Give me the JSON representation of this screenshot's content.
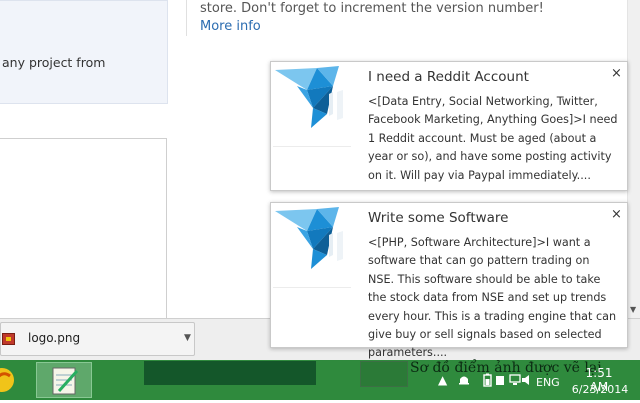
{
  "page": {
    "left_panel_text": "any project from",
    "main_text": "store. Don't forget to increment the version number!",
    "main_link": "More info"
  },
  "download_bar": {
    "file_name": "logo.png"
  },
  "notifications": [
    {
      "title": "I need a Reddit Account",
      "body": "<[Data Entry, Social Networking, Twitter, Facebook Marketing, Anything Goes]>I need 1 Reddit account. Must be aged (about a year or so), and have some posting activity on it. Will pay via Paypal immediately....",
      "close": "×"
    },
    {
      "title": "Write some Software",
      "body": "<[PHP, Software Architecture]>I want a software that can go pattern trading on NSE. This software should be able to take the stock data from NSE and set up trends every hour. This is a trading engine that can give buy or sell signals based on selected parameters....",
      "close": "×"
    }
  ],
  "taskbar": {
    "thumbnail_text": "Sơ đồ điểm ảnh được vẽ lại",
    "language": "ENG",
    "time": "1:51 AM",
    "date": "6/23/2014"
  },
  "colors": {
    "taskbar": "#2f8a3d",
    "logo_blue": "#1d8fd6",
    "link": "#2b6cb0"
  },
  "icons": [
    "start-icon",
    "notepad-app-icon",
    "up-arrow-icon",
    "notification-icon",
    "battery-icon",
    "network-icon",
    "volume-icon"
  ]
}
